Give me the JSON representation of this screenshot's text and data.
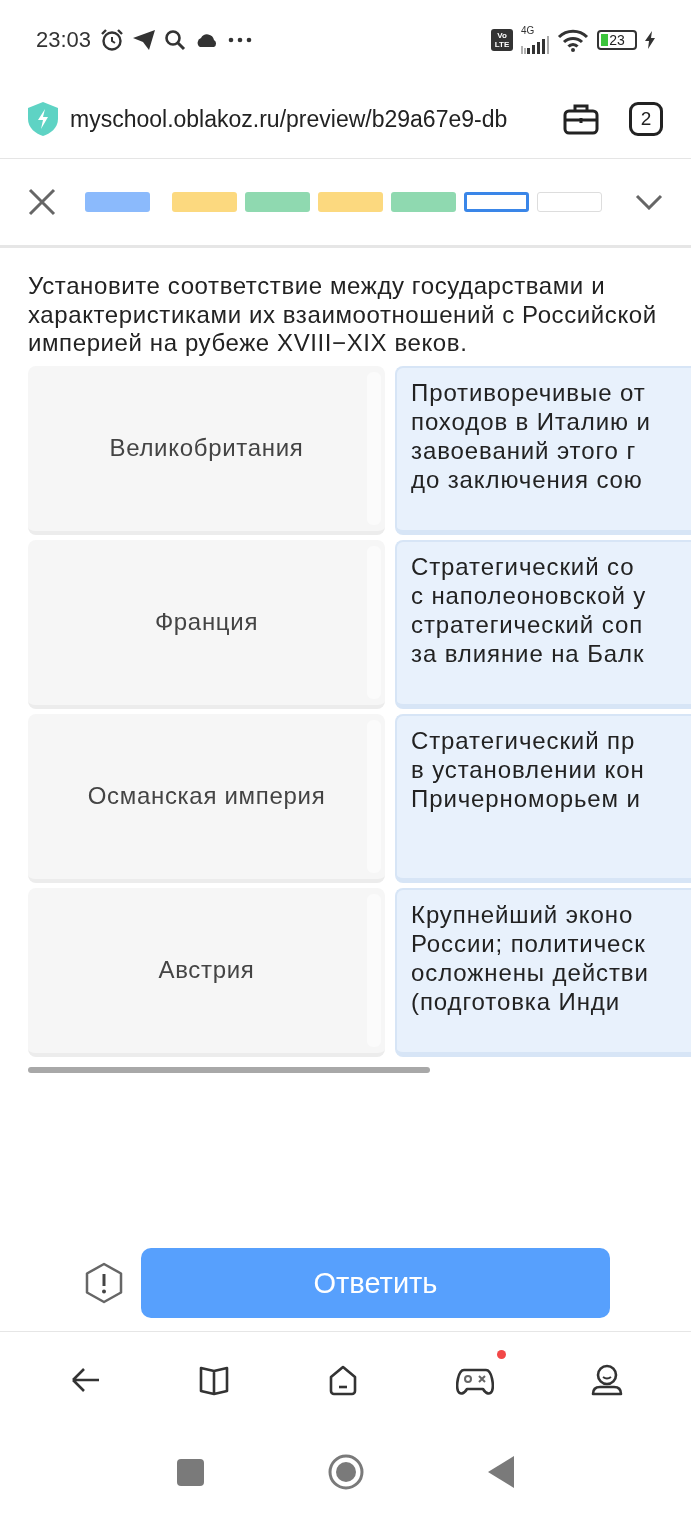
{
  "status_bar": {
    "time": "23:03",
    "volte": "Vo LTE",
    "network": "4G",
    "battery": "23"
  },
  "browser": {
    "url": "myschool.oblakoz.ru/preview/b29a67e9-db",
    "tab_count": "2"
  },
  "progress": {
    "segments": [
      {
        "color": "#8bbafc",
        "selected": false
      },
      {
        "color": "#fcd97f",
        "selected": false
      },
      {
        "color": "#8fd9b0",
        "selected": false
      },
      {
        "color": "#fcd97f",
        "selected": false
      },
      {
        "color": "#8fd9b0",
        "selected": false
      },
      {
        "color": "#ffffff",
        "selected": true
      },
      {
        "color": "#ffffff",
        "selected": false
      }
    ]
  },
  "question": "Установите соответствие между государствами и характеристиками их взаимоотношений с Российской империей на рубеже XVIII−XIX веков.",
  "pairs": [
    {
      "left": "Великобритания",
      "right": [
        "Противоречивые от",
        "походов в Италию и",
        "завоеваний этого г",
        "до заключения сою"
      ]
    },
    {
      "left": "Франция",
      "right": [
        "Стратегический со",
        "с наполеоновской у",
        "стратегический соп",
        "за влияние на Балк"
      ]
    },
    {
      "left": "Османская империя",
      "right": [
        "Стратегический пр",
        "в установлении кон",
        "Причерноморьем и"
      ]
    },
    {
      "left": "Австрия",
      "right": [
        "Крупнейший эконо",
        "России; политическ",
        "осложнены действи",
        "(подготовка Инди"
      ]
    }
  ],
  "answer_button": "Ответить",
  "nav_items": [
    {
      "kind": "back",
      "notification": false
    },
    {
      "kind": "book",
      "notification": false
    },
    {
      "kind": "home",
      "notification": false
    },
    {
      "kind": "game",
      "notification": true
    },
    {
      "kind": "profile",
      "notification": false
    }
  ]
}
